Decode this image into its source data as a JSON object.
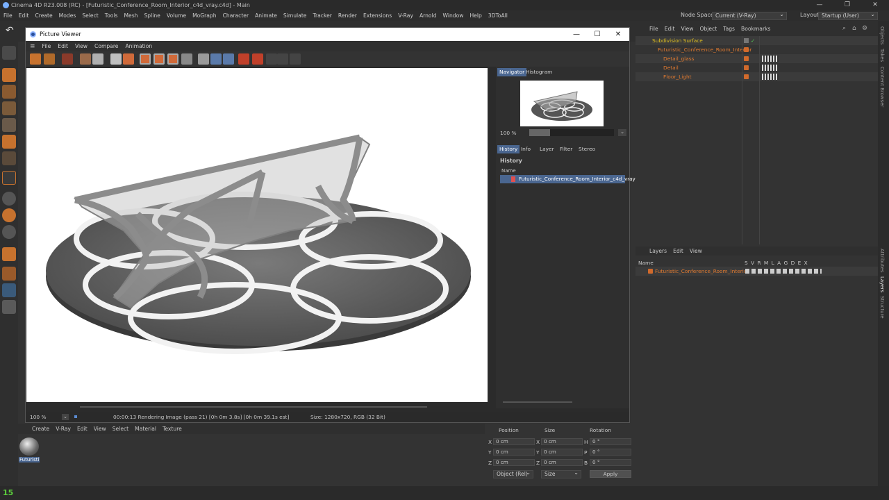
{
  "app": {
    "title": "Cinema 4D R23.008 (RC) - [Futuristic_Conference_Room_Interior_c4d_vray.c4d] - Main",
    "menu": [
      "File",
      "Edit",
      "Create",
      "Modes",
      "Select",
      "Tools",
      "Mesh",
      "Spline",
      "Volume",
      "MoGraph",
      "Character",
      "Animate",
      "Simulate",
      "Tracker",
      "Render",
      "Extensions",
      "V-Ray",
      "Arnold",
      "Window",
      "Help",
      "3DToAll"
    ],
    "node_space_label": "Node Space:",
    "node_space_value": "Current (V-Ray)",
    "layout_label": "Layout:",
    "layout_value": "Startup (User)",
    "frame_counter": "15"
  },
  "side_tabs": [
    "Objects",
    "Takes",
    "Content Browser",
    "Attributes",
    "Layers",
    "Structure"
  ],
  "picture_viewer": {
    "title": "Picture Viewer",
    "menu": [
      "File",
      "Edit",
      "View",
      "Compare",
      "Animation"
    ],
    "tabs_top": [
      "Navigator",
      "Histogram"
    ],
    "nav_zoom": "100 %",
    "tabs_bottom": [
      "History",
      "Info",
      "Layer",
      "Filter",
      "Stereo"
    ],
    "history_header": "History",
    "name_col": "Name",
    "history_item": "Futuristic_Conference_Room_Interior_c4d_vray",
    "zoom": "100 %",
    "render_status": "00:00:13 Rendering Image (pass 21) [0h  0m  3.8s] [0h  0m 39.1s est]",
    "size_info": "Size: 1280x720, RGB (32 Bit)"
  },
  "objects": {
    "menu": [
      "File",
      "Edit",
      "View",
      "Object",
      "Tags",
      "Bookmarks"
    ],
    "items": [
      {
        "label": "Subdivision Surface",
        "color": "#e0c020"
      },
      {
        "label": "Futuristic_Conference_Room_Interior",
        "color": "#e07a30"
      },
      {
        "label": "Detail_glass",
        "color": "#e07a30"
      },
      {
        "label": "Detail",
        "color": "#e07a30"
      },
      {
        "label": "Floor_Light",
        "color": "#e07a30"
      }
    ]
  },
  "layers": {
    "menu": [
      "Layers",
      "Edit",
      "View"
    ],
    "name_col": "Name",
    "flags": "S V R M L A G D E X",
    "item": "Futuristic_Conference_Room_Interior"
  },
  "materials": {
    "menu": [
      "Create",
      "V-Ray",
      "Edit",
      "View",
      "Select",
      "Material",
      "Texture"
    ],
    "item": "Futuristi"
  },
  "coords": {
    "headers": [
      "Position",
      "Size",
      "Rotation"
    ],
    "rows": [
      {
        "axis": "X",
        "pos": "0 cm",
        "size": "0 cm",
        "rot_axis": "H",
        "rot": "0 °"
      },
      {
        "axis": "Y",
        "pos": "0 cm",
        "size": "0 cm",
        "rot_axis": "P",
        "rot": "0 °"
      },
      {
        "axis": "Z",
        "pos": "0 cm",
        "size": "0 cm",
        "rot_axis": "B",
        "rot": "0 °"
      }
    ],
    "mode": "Object (Rel)",
    "size_mode": "Size",
    "apply": "Apply"
  }
}
